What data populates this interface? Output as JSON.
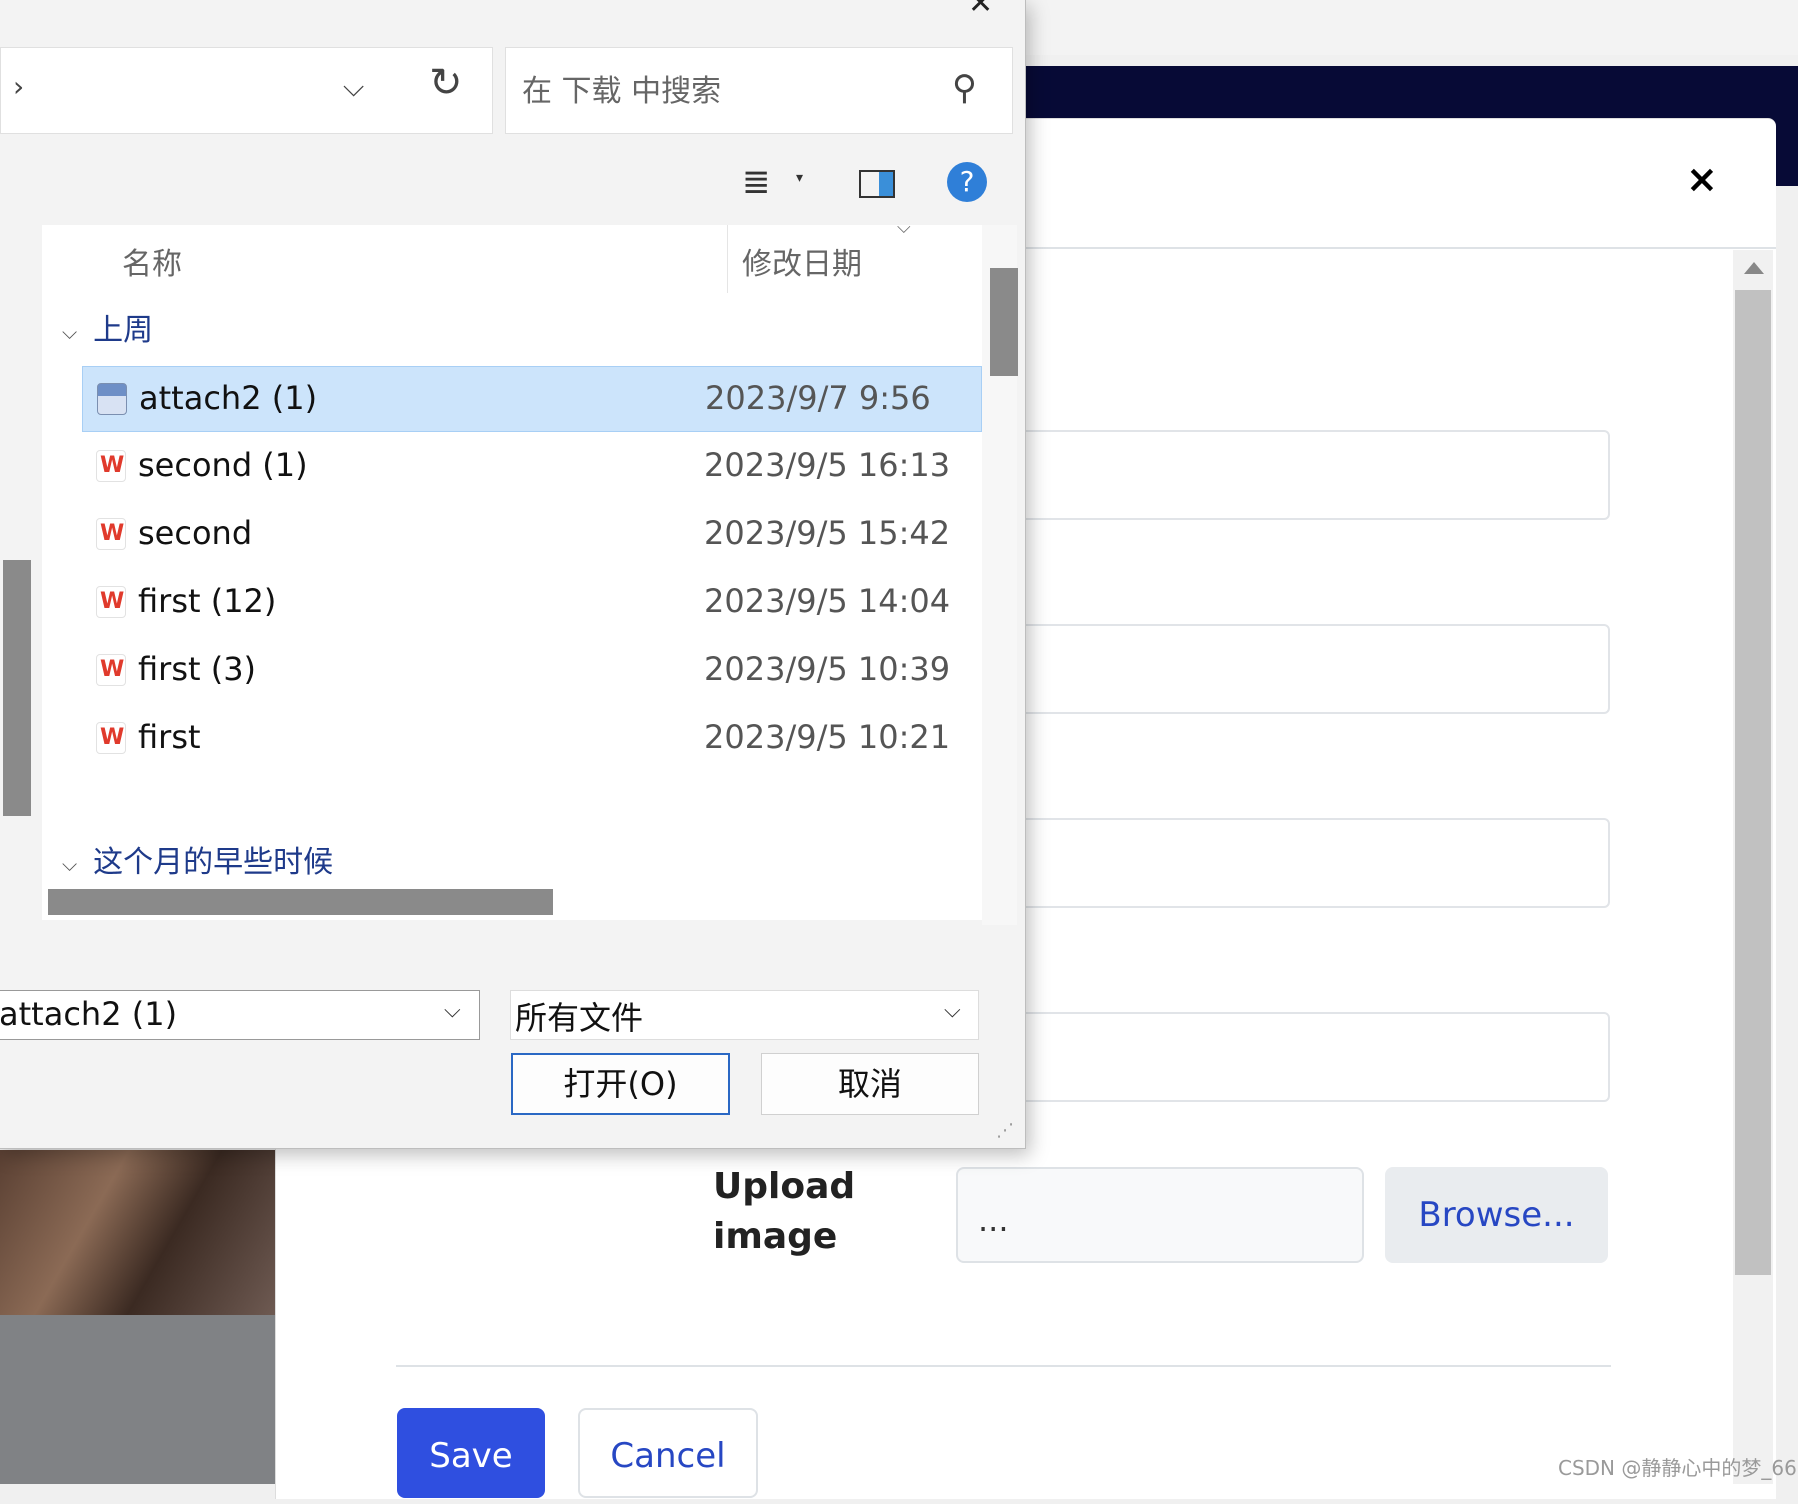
{
  "background_page": {
    "modal": {
      "close_icon": "×",
      "upload_label": "Upload image",
      "file_input_value": "...",
      "browse_label": "Browse...",
      "save_label": "Save",
      "cancel_label": "Cancel"
    },
    "watermark": "CSDN @静静心中的梦_66"
  },
  "file_dialog": {
    "close_icon": "✕",
    "address_chevron": "›",
    "address_dropdown_icon": "chevron-down-icon",
    "refresh_icon": "refresh-icon",
    "search": {
      "placeholder": "在 下载 中搜索",
      "icon": "search-icon"
    },
    "toolbar": {
      "view_icon": "list-view-icon",
      "preview_pane_icon": "preview-pane-icon",
      "help_icon": "?"
    },
    "columns": {
      "name": "名称",
      "date": "修改日期"
    },
    "groups": [
      {
        "label": "上周",
        "files": [
          {
            "name": "attach2 (1)",
            "date": "2023/9/7 9:56",
            "icon": "image-file-icon",
            "selected": true
          },
          {
            "name": "second (1)",
            "date": "2023/9/5 16:13",
            "icon": "wps-icon",
            "selected": false
          },
          {
            "name": "second",
            "date": "2023/9/5 15:42",
            "icon": "wps-icon",
            "selected": false
          },
          {
            "name": "first (12)",
            "date": "2023/9/5 14:04",
            "icon": "wps-icon",
            "selected": false
          },
          {
            "name": "first (3)",
            "date": "2023/9/5 10:39",
            "icon": "wps-icon",
            "selected": false
          },
          {
            "name": "first",
            "date": "2023/9/5 10:21",
            "icon": "wps-icon",
            "selected": false
          }
        ]
      },
      {
        "label": "这个月的早些时候",
        "files": []
      }
    ],
    "filename_value": "attach2 (1)",
    "file_type": "所有文件",
    "open_label": "打开(O)",
    "cancel_label": "取消",
    "wps_glyph": "W"
  }
}
